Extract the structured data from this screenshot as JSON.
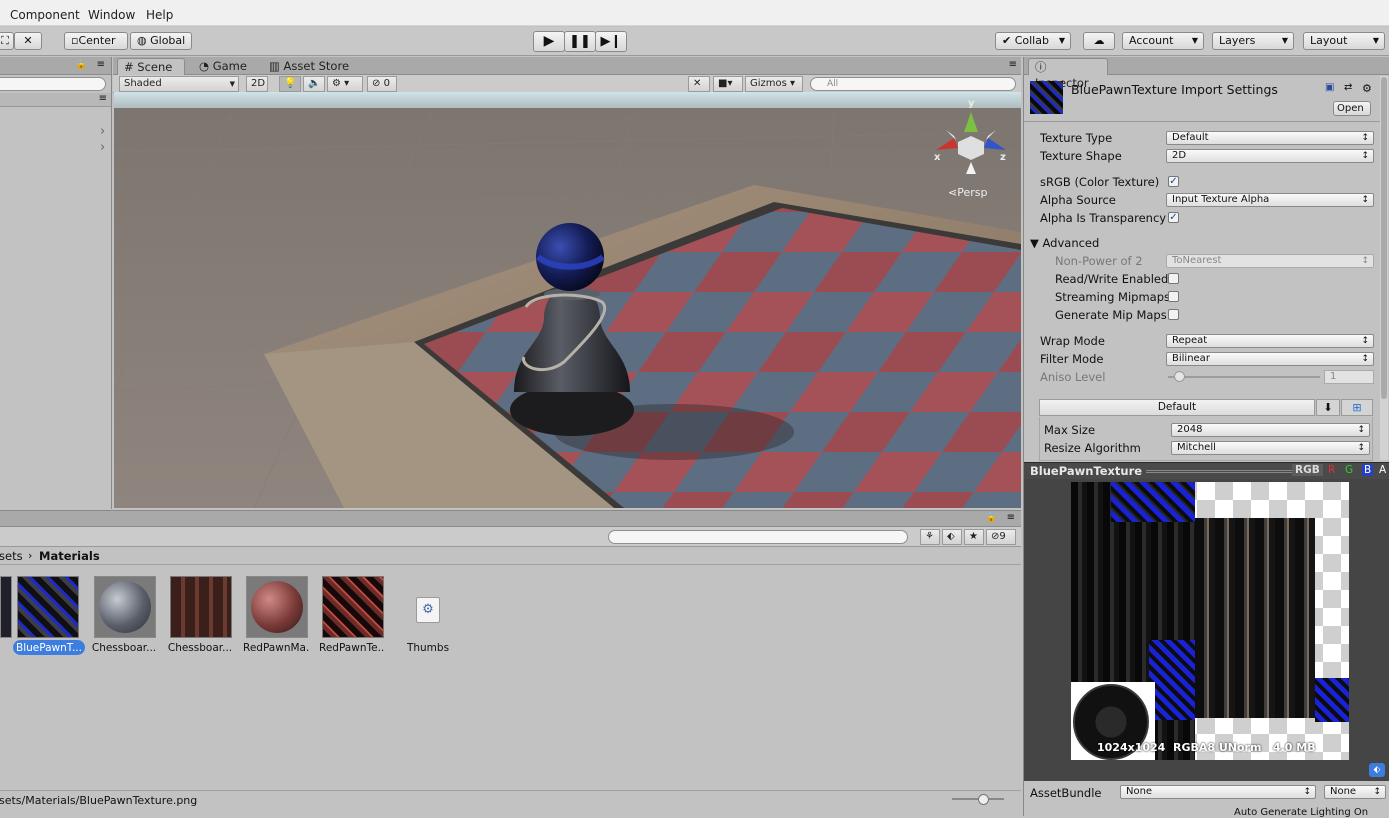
{
  "menubar": {
    "items": [
      "Component",
      "Window",
      "Help"
    ]
  },
  "toolbar": {
    "center_label": "Center",
    "global_label": "Global",
    "collab_label": "Collab",
    "account_label": "Account",
    "layers_label": "Layers",
    "layout_label": "Layout"
  },
  "scene_tabs": [
    "Scene",
    "Game",
    "Asset Store"
  ],
  "scene_toolbar": {
    "shading_mode": "Shaded",
    "mode_2d": "2D",
    "hidden_count": "0",
    "gizmos_label": "Gizmos",
    "search_placeholder": "All",
    "persp_label": "Persp",
    "axis_x": "x",
    "axis_y": "y",
    "axis_z": "z"
  },
  "inspector": {
    "tab_label": "Inspector",
    "title": "BluePawnTexture Import Settings",
    "open_label": "Open",
    "fields": {
      "texture_type_label": "Texture Type",
      "texture_type": "Default",
      "texture_shape_label": "Texture Shape",
      "texture_shape": "2D",
      "srgb_label": "sRGB (Color Texture)",
      "alpha_source_label": "Alpha Source",
      "alpha_source": "Input Texture Alpha",
      "alpha_transparency_label": "Alpha Is Transparency",
      "advanced_label": "Advanced",
      "npot_label": "Non-Power of 2",
      "npot": "ToNearest",
      "readwrite_label": "Read/Write Enabled",
      "streaming_label": "Streaming Mipmaps",
      "genmip_label": "Generate Mip Maps",
      "wrap_label": "Wrap Mode",
      "wrap": "Repeat",
      "filter_label": "Filter Mode",
      "filter": "Bilinear",
      "aniso_label": "Aniso Level",
      "aniso": "1",
      "platform_tab": "Default",
      "maxsize_label": "Max Size",
      "maxsize": "2048",
      "resize_label": "Resize Algorithm",
      "resize": "Mitchell"
    },
    "checks": {
      "srgb": true,
      "alpha_transparency": true,
      "readwrite": false,
      "streaming": false,
      "genmip": false
    },
    "preview": {
      "title": "BluePawnTexture",
      "channels": [
        "RGB",
        "R",
        "G",
        "B",
        "A"
      ],
      "info": "1024x1024  RGBA8 UNorm   4.0 MB"
    },
    "assetbundle_label": "AssetBundle",
    "assetbundle_value": "None",
    "assetbundle_variant": "None",
    "autogen_text": "Auto Generate Lighting On"
  },
  "project": {
    "breadcrumb_parent": "sets",
    "breadcrumb_current": "Materials",
    "hidden_count": "9",
    "assets": [
      {
        "label": "BluePawnT..."
      },
      {
        "label": "Chessboar..."
      },
      {
        "label": "Chessboar..."
      },
      {
        "label": "RedPawnMa..."
      },
      {
        "label": "RedPawnTe..."
      },
      {
        "label": "Thumbs"
      }
    ],
    "status_path": "sets/Materials/BluePawnTexture.png"
  },
  "colors": {
    "selection_blue": "#3d7de0",
    "editor_grey": "#c2c2c2",
    "dark_panel": "#444444"
  }
}
